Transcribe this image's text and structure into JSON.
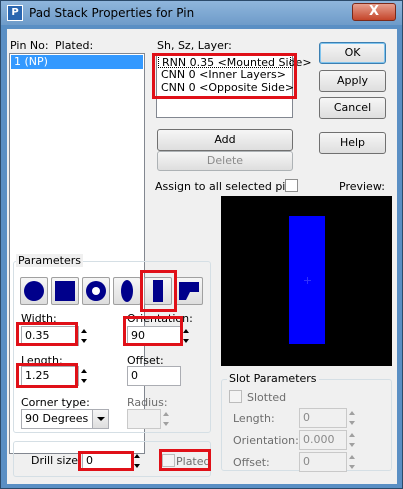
{
  "window": {
    "title": "Pad Stack Properties for Pin",
    "close_glyph": "X"
  },
  "pin_list": {
    "header_pin_no": "Pin No:",
    "header_plated": "Plated:",
    "items": [
      "1 (NP)"
    ]
  },
  "layers": {
    "header": "Sh, Sz, Layer:",
    "items": [
      "RNN 0.35 <Mounted Side>",
      "CNN 0 <Inner Layers>",
      "CNN 0 <Opposite Side>"
    ]
  },
  "buttons": {
    "ok": "OK",
    "apply": "Apply",
    "cancel": "Cancel",
    "help": "Help",
    "add": "Add",
    "delete": "Delete"
  },
  "assign_all_label": "Assign to all selected pins",
  "preview_label": "Preview:",
  "parameters": {
    "title": "Parameters",
    "shapes": [
      "round-pad",
      "square-pad",
      "annular-pad",
      "oval-pad",
      "rectangle-pad",
      "custom-pad"
    ],
    "width_label": "Width:",
    "width_value": "0.35",
    "orientation_label": "Orientation:",
    "orientation_value": "90",
    "length_label": "Length:",
    "length_value": "1.25",
    "offset_label": "Offset:",
    "offset_value": "0",
    "corner_type_label": "Corner type:",
    "corner_type_value": "90 Degrees",
    "radius_label": "Radius:",
    "radius_value": ""
  },
  "slot": {
    "title": "Slot Parameters",
    "slotted_label": "Slotted",
    "length_label": "Length:",
    "length_value": "0",
    "orientation_label": "Orientation:",
    "orientation_value": "0.000",
    "offset_label": "Offset:",
    "offset_value": "0"
  },
  "drill": {
    "label": "Drill size:",
    "value": "0",
    "plated_label": "Plated"
  },
  "colors": {
    "pad": "#0000ff",
    "preview_bg": "#000000",
    "highlight": "#e01018",
    "selection": "#3399ff"
  }
}
